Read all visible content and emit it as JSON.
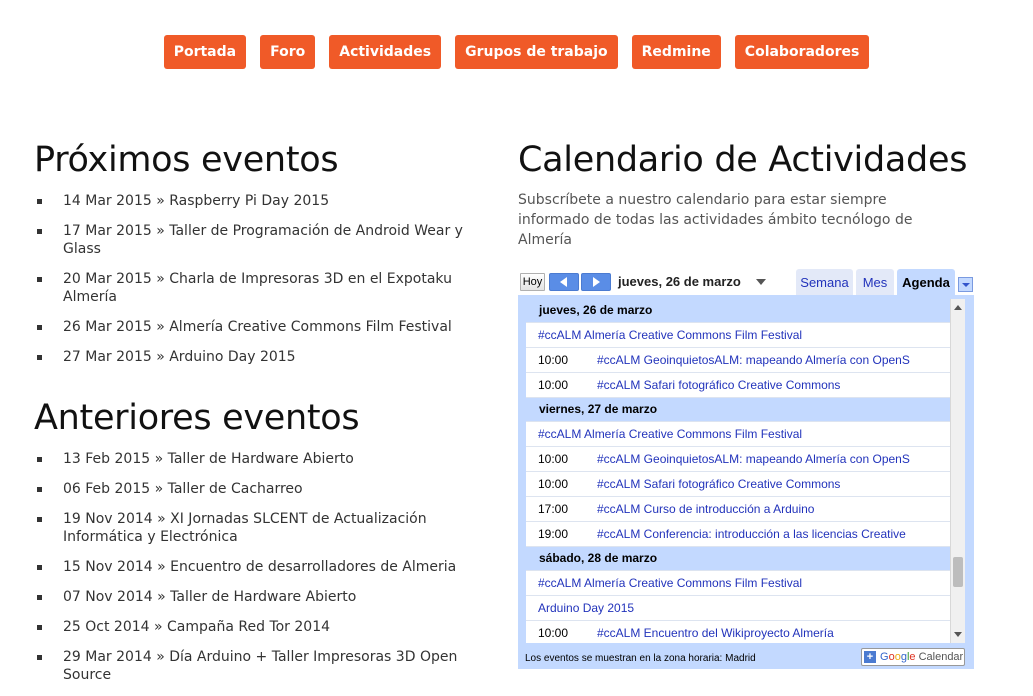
{
  "nav": {
    "items": [
      "Portada",
      "Foro",
      "Actividades",
      "Grupos de trabajo",
      "Redmine",
      "Colaboradores"
    ],
    "accent_color": "#f05a28"
  },
  "upcoming": {
    "heading": "Próximos eventos",
    "events": [
      {
        "date": "14 Mar 2015",
        "title": "Raspberry Pi Day 2015"
      },
      {
        "date": "17 Mar 2015",
        "title": "Taller de Programación de Android Wear y Glass"
      },
      {
        "date": "20 Mar 2015",
        "title": "Charla de Impresoras 3D en el Expotaku Almería"
      },
      {
        "date": "26 Mar 2015",
        "title": "Almería Creative Commons Film Festival"
      },
      {
        "date": "27 Mar 2015",
        "title": "Arduino Day 2015"
      }
    ]
  },
  "past": {
    "heading": "Anteriores eventos",
    "events": [
      {
        "date": "13 Feb 2015",
        "title": "Taller de Hardware Abierto"
      },
      {
        "date": "06 Feb 2015",
        "title": "Taller de Cacharreo"
      },
      {
        "date": "19 Nov 2014",
        "title": "XI Jornadas SLCENT de Actualización Informática y Electrónica"
      },
      {
        "date": "15 Nov 2014",
        "title": "Encuentro de desarrolladores de Almeria"
      },
      {
        "date": "07 Nov 2014",
        "title": "Taller de Hardware Abierto"
      },
      {
        "date": "25 Oct 2014",
        "title": "Campaña Red Tor 2014"
      },
      {
        "date": "29 Mar 2014",
        "title": "Día Arduino + Taller Impresoras 3D Open Source"
      }
    ]
  },
  "calendar_section": {
    "heading": "Calendario de Actividades",
    "description": "Subscríbete a nuestro calendario para estar siempre informado de todas las actividades ámbito tecnólogo de Almería"
  },
  "calendar": {
    "today_label": "Hoy",
    "current_date": "jueves, 26 de marzo",
    "tabs": [
      {
        "label": "Semana",
        "active": false
      },
      {
        "label": "Mes",
        "active": false
      },
      {
        "label": "Agenda",
        "active": true
      }
    ],
    "days": [
      {
        "label": "jueves, 26 de marzo",
        "events": [
          {
            "time": "",
            "title": "#ccALM Almería Creative Commons Film Festival"
          },
          {
            "time": "10:00",
            "title": "#ccALM GeoinquietosALM: mapeando Almería con OpenS"
          },
          {
            "time": "10:00",
            "title": "#ccALM Safari fotográfico Creative Commons"
          }
        ]
      },
      {
        "label": "viernes, 27 de marzo",
        "events": [
          {
            "time": "",
            "title": "#ccALM Almería Creative Commons Film Festival"
          },
          {
            "time": "10:00",
            "title": "#ccALM GeoinquietosALM: mapeando Almería con OpenS"
          },
          {
            "time": "10:00",
            "title": "#ccALM Safari fotográfico Creative Commons"
          },
          {
            "time": "17:00",
            "title": "#ccALM Curso de introducción a Arduino"
          },
          {
            "time": "19:00",
            "title": "#ccALM Conferencia: introducción a las licencias Creative"
          }
        ]
      },
      {
        "label": "sábado, 28 de marzo",
        "events": [
          {
            "time": "",
            "title": "#ccALM Almería Creative Commons Film Festival"
          },
          {
            "time": "",
            "title": "Arduino Day 2015"
          },
          {
            "time": "10:00",
            "title": "#ccALM Encuentro del Wikiproyecto Almería"
          }
        ]
      }
    ],
    "footer_text": "Los eventos se muestran en la zona horaria: Madrid",
    "badge_brand": "Google",
    "badge_text": "Calendar"
  }
}
